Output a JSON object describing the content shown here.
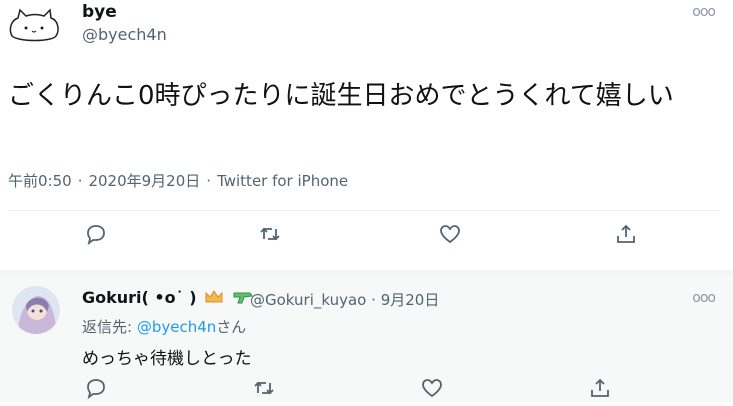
{
  "tweet": {
    "author_name": "bye",
    "author_handle": "@byech4n",
    "text": "ごくりんこ0時ぴったりに誕生日おめでとうくれて嬉しい",
    "time": "午前0:50",
    "date": "2020年9月20日",
    "source": "Twitter for iPhone",
    "separator": "·"
  },
  "reply": {
    "author_name": "Gokuri( •o˙ )",
    "author_handle": "@Gokuri_kuyao",
    "date": "9月20日",
    "separator": "·",
    "replying_prefix": "返信先: ",
    "replying_to": "@byech4n",
    "replying_suffix": "さん",
    "text": "めっちゃ待機しとった"
  },
  "icons": {
    "more": "more-icon",
    "reply": "reply-icon",
    "retweet": "retweet-icon",
    "like": "like-icon",
    "share": "share-icon",
    "crown_badge": "crown-icon",
    "gun_badge": "water-gun-icon"
  },
  "colors": {
    "mention": "#1d9bf0",
    "muted_text": "#536471",
    "reply_background": "#f7f9f9"
  }
}
